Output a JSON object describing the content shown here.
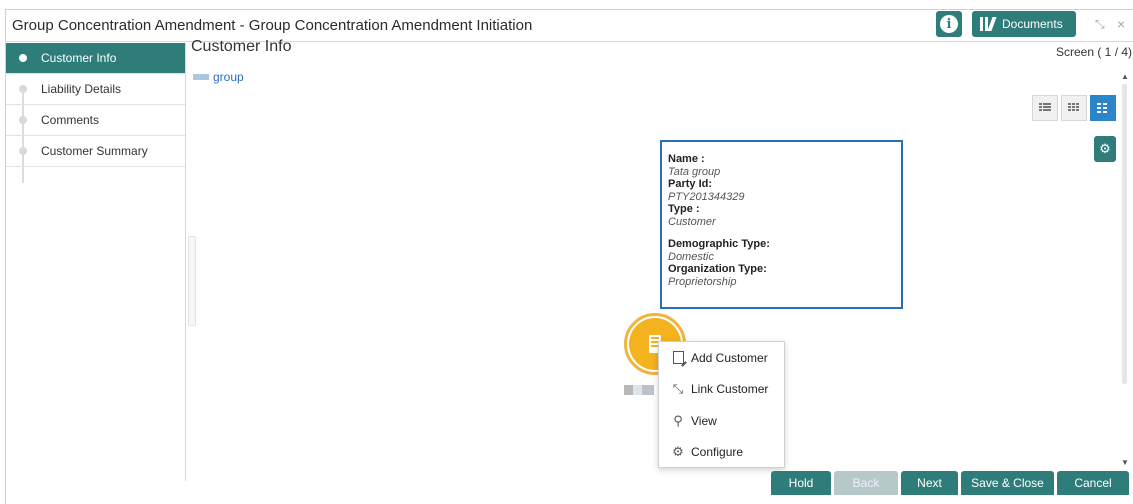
{
  "window": {
    "title": "Group Concentration Amendment - Group Concentration Amendment Initiation",
    "documents_label": "Documents",
    "info_glyph": "i",
    "minimize_glyph": "⤡",
    "close_glyph": "×"
  },
  "sidebar": {
    "items": [
      {
        "label": "Customer Info",
        "active": true
      },
      {
        "label": "Liability Details",
        "active": false
      },
      {
        "label": "Comments",
        "active": false
      },
      {
        "label": "Customer Summary",
        "active": false
      }
    ]
  },
  "main": {
    "title": "Customer Info",
    "screen_counter": "Screen ( 1 / 4)",
    "breadcrumb": "group"
  },
  "info_card": {
    "name_label": "Name :",
    "name_value": "Tata group",
    "party_label": "Party Id:",
    "party_value": "PTY201344329",
    "type_label": "Type :",
    "type_value": "Customer",
    "demo_label": "Demographic Type:",
    "demo_value": "Domestic",
    "org_label": "Organization Type:",
    "org_value": "Proprietorship"
  },
  "context_menu": {
    "items": [
      {
        "label": "Add Customer",
        "icon": "add-document-icon"
      },
      {
        "label": "Link Customer",
        "icon": "link-arrows-icon"
      },
      {
        "label": "View",
        "icon": "search-icon"
      },
      {
        "label": "Configure",
        "icon": "gear-icon"
      }
    ]
  },
  "footer": {
    "hold": "Hold",
    "back": "Back",
    "next": "Next",
    "save_close": "Save & Close",
    "cancel": "Cancel"
  },
  "colors": {
    "primary": "#2e7d7a",
    "link": "#2a6ebb",
    "node": "#f3b21e",
    "view_active": "#2a86c8"
  }
}
